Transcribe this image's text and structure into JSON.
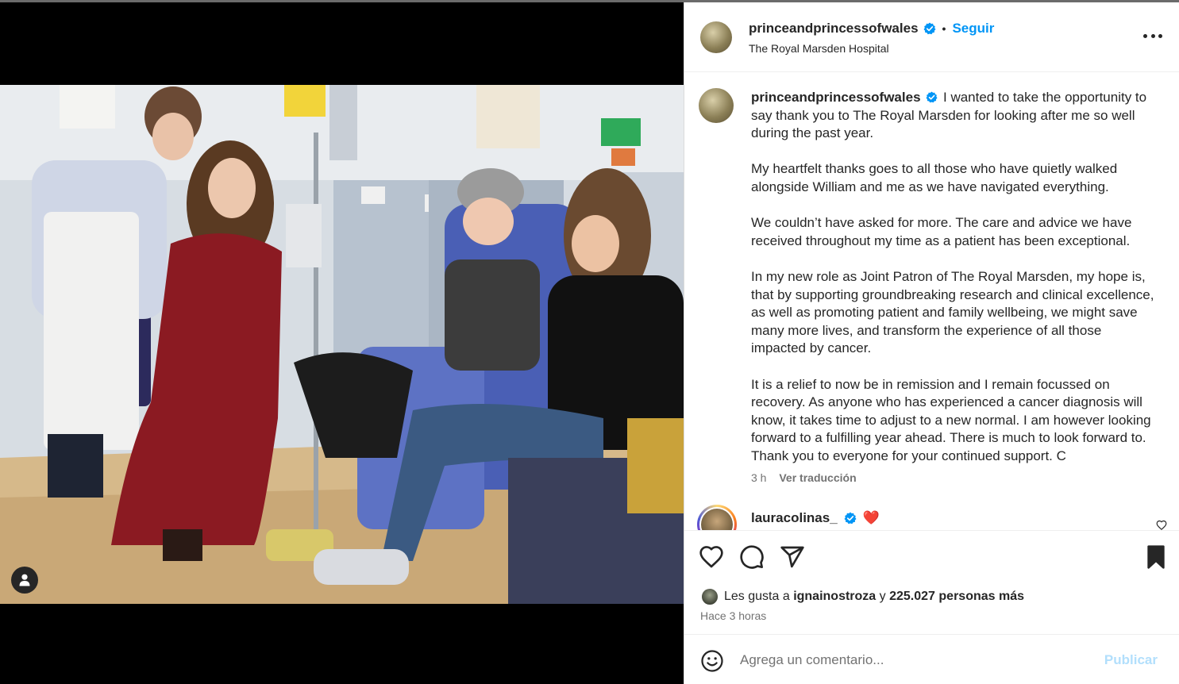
{
  "post": {
    "author": "princeandprincessofwales",
    "follow_label": "Seguir",
    "dot": "•",
    "location": "The Royal Marsden Hospital"
  },
  "caption": {
    "username": "princeandprincessofwales",
    "paragraphs": [
      "I wanted to take the opportunity to say thank you to The Royal Marsden for looking after me so well during the past year.",
      "My heartfelt thanks goes to all those who have quietly walked alongside William and me as we have navigated everything.",
      "We couldn’t have asked for more. The care and advice we have received throughout my time as a patient has been exceptional.",
      "In my new role as Joint Patron of The Royal Marsden, my hope is, that by supporting groundbreaking research and clinical excellence, as well as promoting patient and family wellbeing, we might save many more lives, and transform the experience of all those impacted by cancer.",
      "It is a relief to now be in remission and I remain focussed on recovery. As anyone who has experienced a cancer diagnosis will know, it takes time to adjust to a new normal. I am however looking forward to a fulfilling year ahead. There is much to look forward to. Thank you to everyone for your continued support. C"
    ],
    "age": "3 h",
    "translate_label": "Ver traducción"
  },
  "comment": {
    "username": "lauracolinas_",
    "emoji": "❤️"
  },
  "likes": {
    "prefix": "Les gusta a",
    "user": "ignainostroza",
    "connector": "y",
    "count_text": "225.027 personas más"
  },
  "timestamp": "Hace 3 horas",
  "composer": {
    "placeholder": "Agrega un comentario...",
    "publish_label": "Publicar"
  },
  "icons": {
    "like": "heart-icon",
    "comment": "comment-bubble-icon",
    "share": "paper-plane-icon",
    "save": "bookmark-icon",
    "emoji": "emoji-smile-icon",
    "more": "more-options-icon",
    "user_tag": "user-tag-icon"
  },
  "colors": {
    "accent": "#0095f6",
    "verified": "#0095f6",
    "publish_disabled": "#b2dffc"
  }
}
